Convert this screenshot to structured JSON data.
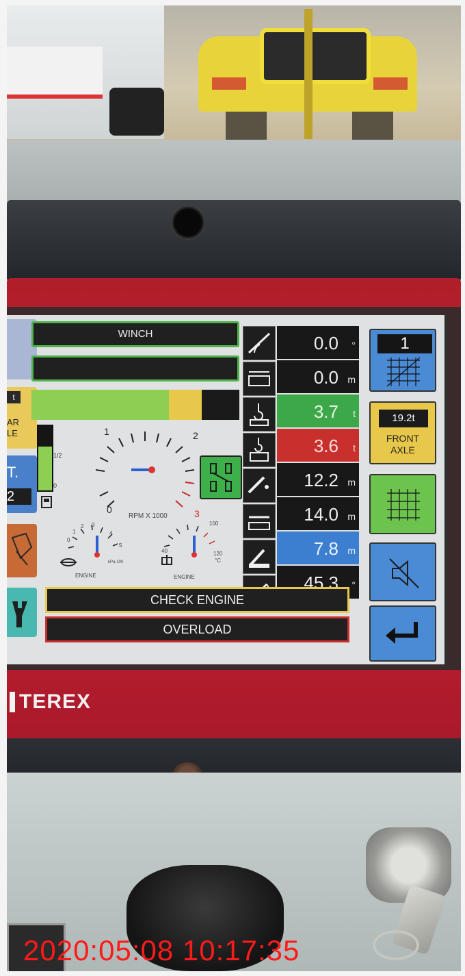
{
  "screen": {
    "banners": {
      "top": "WINCH",
      "second": ""
    },
    "load_indicator": {
      "green_fraction": 0.66,
      "yellow_fraction": 0.16
    },
    "gauges": {
      "rpm_tick_0": "0",
      "rpm_tick_1": "1",
      "rpm_tick_2": "2",
      "rpm_tick_3": "3",
      "rpm_caption": "RPM X 1000",
      "half_label": "1/2",
      "zero_label": "0",
      "oil_ticks": [
        "0",
        "1",
        "2",
        "3",
        "4",
        "5"
      ],
      "oil_caption": "ENGINE",
      "oil_unit": "kPa-100",
      "temp_ticks": [
        "40",
        "100",
        "120"
      ],
      "temp_unit": "°C",
      "temp_caption": "ENGINE"
    },
    "readouts": [
      {
        "icon": "boom-angle-icon",
        "value": "0.0",
        "unit": "°",
        "color": "#181818"
      },
      {
        "icon": "slew-icon",
        "value": "0.0",
        "unit": "m",
        "color": "#181818"
      },
      {
        "icon": "hook-load-icon",
        "value": "3.7",
        "unit": "t",
        "color": "#3da84a"
      },
      {
        "icon": "hook-max-icon",
        "value": "3.6",
        "unit": "t",
        "color": "#c8302e"
      },
      {
        "icon": "boom-length-icon",
        "value": "12.2",
        "unit": "m",
        "color": "#181818"
      },
      {
        "icon": "radius-icon",
        "value": "14.0",
        "unit": "m",
        "color": "#181818"
      },
      {
        "icon": "height-icon",
        "value": "7.8",
        "unit": "m",
        "color": "#3c7fd0"
      },
      {
        "icon": "jib-angle-icon",
        "value": "45.3",
        "unit": "°",
        "color": "#181818"
      }
    ],
    "left_column": {
      "item2_tag": "t",
      "item2_text_line1": "AR",
      "item2_text_line2": "LE",
      "item3_big": "T.",
      "item3_dark": "2"
    },
    "right_column": {
      "chart_number": "1",
      "front_axle_weight": "19.2t",
      "front_axle_label_line1": "FRONT",
      "front_axle_label_line2": "AXLE"
    },
    "alerts": {
      "check_engine": "CHECK ENGINE",
      "overload": "OVERLOAD"
    }
  },
  "brand": "TEREX",
  "timestamp": "2020:05:08 10:17:35",
  "colors": {
    "panel_red": "#c72231",
    "screen_bg": "#dfe1e2",
    "timestamp_red": "#ff1a1a"
  }
}
